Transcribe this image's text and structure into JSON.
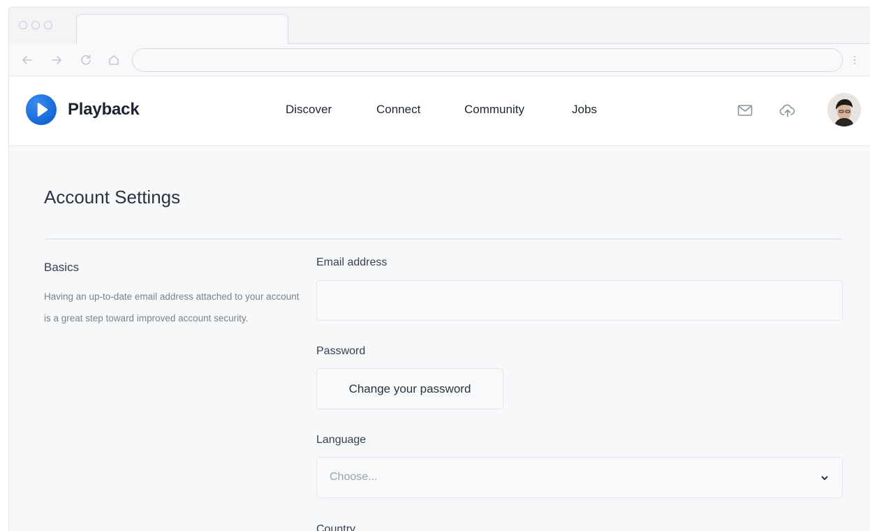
{
  "browser": {
    "icons": {
      "back": "arrow-left-icon",
      "forward": "arrow-right-icon",
      "reload": "reload-icon",
      "home": "home-icon",
      "menu": "more-vertical-icon"
    },
    "address_value": ""
  },
  "header": {
    "brand": "Playback",
    "brand_color": "#1466d6",
    "nav": [
      {
        "label": "Discover"
      },
      {
        "label": "Connect"
      },
      {
        "label": "Community"
      },
      {
        "label": "Jobs"
      }
    ],
    "icons": [
      "mail-icon",
      "upload-cloud-icon",
      "avatar"
    ]
  },
  "page": {
    "title": "Account Settings",
    "section": {
      "title": "Basics",
      "description": "Having an up-to-date email address attached to your account is a great step toward improved account security."
    },
    "fields": {
      "email": {
        "label": "Email address",
        "value": ""
      },
      "password": {
        "label": "Password",
        "button": "Change your password"
      },
      "language": {
        "label": "Language",
        "selected": "Choose..."
      },
      "country": {
        "label": "Country"
      }
    }
  }
}
